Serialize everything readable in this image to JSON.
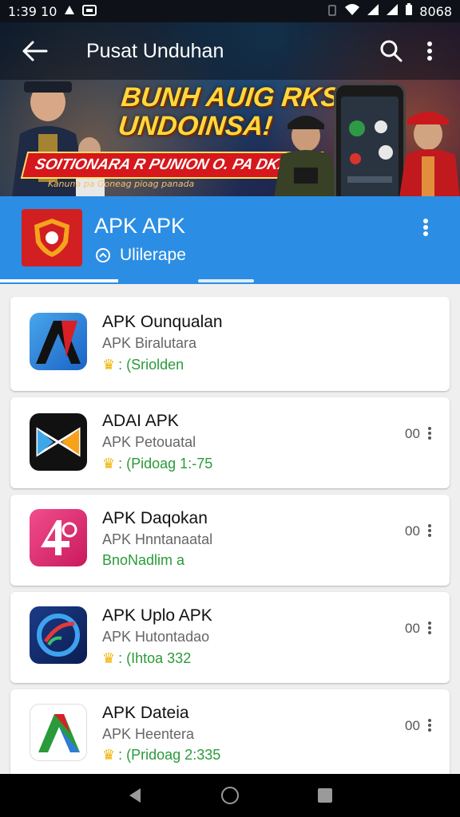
{
  "status_bar": {
    "time": "1:39 10",
    "battery": "8068"
  },
  "app_bar": {
    "title": "Pusat Unduhan"
  },
  "banner": {
    "headline_line1": "BUNH AUIG RKS!",
    "headline_line2": "UNDOINSA!",
    "ribbon": "SOITIONARA R PUNION O. PA DKADI!",
    "ribbon_sub": "Kanuna pa Goneag pioag panada"
  },
  "app_info": {
    "name": "APK APK",
    "subtitle": "Ulilerape"
  },
  "apps": [
    {
      "title": "APK Ounqualan",
      "subtitle": "APK Biralutara",
      "meta": ": (Sriolden",
      "has_star": true,
      "count": "",
      "has_menu": false
    },
    {
      "title": "ADAI APK",
      "subtitle": "APK Petouatal",
      "meta": ": (Pidoag 1:-75",
      "has_star": true,
      "count": "00",
      "has_menu": true
    },
    {
      "title": "APK Daqokan",
      "subtitle": "APK Hnntanaatal",
      "meta": "BnoNadlim a",
      "has_star": false,
      "count": "00",
      "has_menu": true
    },
    {
      "title": "APK Uplo APK",
      "subtitle": "APK Hutontadao",
      "meta": ": (Ihtoa 332",
      "has_star": true,
      "count": "00",
      "has_menu": true
    },
    {
      "title": "APK Dateia",
      "subtitle": "APK Heentera",
      "meta": ": (Pridoag 2:335",
      "has_star": true,
      "count": "00",
      "has_menu": true
    }
  ],
  "colors": {
    "primary": "#2b8ee4",
    "app_icon_red": "#d21f21",
    "meta_green": "#2a9a3a",
    "star": "#f0b400"
  }
}
